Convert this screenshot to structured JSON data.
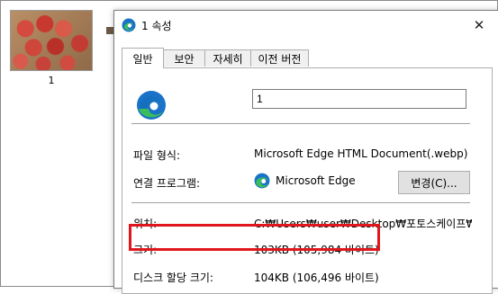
{
  "explorer": {
    "file_label": "1"
  },
  "dialog": {
    "title": "1 속성",
    "close_glyph": "✕",
    "tabs": [
      {
        "label": "일반",
        "active": true
      },
      {
        "label": "보안",
        "active": false
      },
      {
        "label": "자세히",
        "active": false
      },
      {
        "label": "이전 버전",
        "active": false
      }
    ],
    "file_name": "1",
    "file_type_label": "파일 형식:",
    "file_type_value": "Microsoft Edge HTML Document(.webp)",
    "opens_with_label": "연결 프로그램:",
    "opens_with_value": "Microsoft Edge",
    "change_button": "변경(C)...",
    "location_label": "위치:",
    "location_value": "C:₩Users₩user₩Desktop₩포토스케이프₩수정",
    "size_label": "크기:",
    "size_value": "103KB (105,984 바이트)",
    "disk_size_label": "디스크 할당 크기:",
    "disk_size_value": "104KB (106,496 바이트)"
  },
  "icons": {
    "app": "edge-icon",
    "close": "close-icon"
  },
  "colors": {
    "highlight": "#e0161c",
    "edge_blue": "#1a73c8",
    "edge_green": "#3bbd5c"
  }
}
